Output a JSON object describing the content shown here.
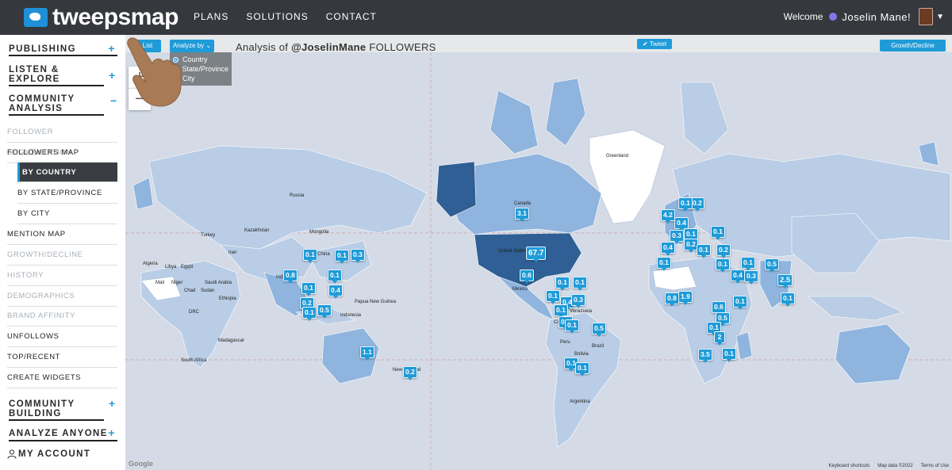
{
  "header": {
    "logo": "tweepsmap",
    "nav": [
      "PLANS",
      "SOLUTIONS",
      "CONTACT"
    ],
    "welcome": "Welcome",
    "user_name": "Joselin Mane!"
  },
  "sidebar": {
    "sections": [
      {
        "label": "PUBLISHING",
        "icon": "+"
      },
      {
        "label": "LISTEN & EXPLORE",
        "icon": "+"
      },
      {
        "label": "COMMUNITY ANALYSIS",
        "icon": "−"
      },
      {
        "label": "COMMUNITY BUILDING",
        "icon": "+"
      },
      {
        "label": "ANALYZE ANYONE",
        "icon": "+"
      },
      {
        "label": "MY ACCOUNT",
        "icon": "user-icon"
      }
    ],
    "items": [
      "FOLLOWER SEGMENTATION",
      "FOLLOWERS MAP",
      "BY COUNTRY",
      "BY STATE/PROVINCE",
      "BY CITY",
      "MENTION MAP",
      "GROWTH/DECLINE",
      "HISTORY",
      "DEMOGRAPHICS",
      "BRAND AFFINITY",
      "UNFOLLOWS",
      "TOP/RECENT",
      "CREATE WIDGETS"
    ]
  },
  "toolbar": {
    "list_label": "List",
    "analyze_label": "Analyze by",
    "tweet_label": "Tweet",
    "growth_label": "Growth/Decline",
    "title_prefix": "Analysis of",
    "title_handle": "@JoselinMane",
    "title_suffix": "FOLLOWERS"
  },
  "analyze_options": [
    "Country",
    "State/Province",
    "City"
  ],
  "analyze_selected": "Country",
  "zoom": {
    "in": "+",
    "out": "−"
  },
  "map_labels": [
    "Russia",
    "Greenland",
    "Kazakhstan",
    "Mongolia",
    "China",
    "India",
    "Iran",
    "Saudi Arabia",
    "Egypt",
    "Libya",
    "Algeria",
    "Mali",
    "Niger",
    "Chad",
    "Sudan",
    "Ethiopia",
    "DRC",
    "Madagascar",
    "South Africa",
    "Indonesia",
    "Papua New Guinea",
    "New Zealand",
    "Brazil",
    "Peru",
    "Bolivia",
    "Argentina",
    "Venezuela",
    "Colombia",
    "Mexico",
    "Canada",
    "United States",
    "Turkey"
  ],
  "markers": [
    "3.1",
    "67.7",
    "0.6",
    "0.1",
    "0.1",
    "0.1",
    "0.4",
    "0.3",
    "0.1",
    "0.1",
    "0.5",
    "0.1",
    "0.1",
    "0.1",
    "0.8",
    "0.1",
    "0.1",
    "0.4",
    "0.2",
    "0.1",
    "0.5",
    "0.3",
    "0.1",
    "0.1",
    "1.1",
    "0.2",
    "4.2",
    "0.2",
    "0.1",
    "0.4",
    "0.3",
    "0.1",
    "0.1",
    "0.4",
    "0.2",
    "0.1",
    "0.1",
    "0.2",
    "0.1",
    "0.1",
    "0.4",
    "0.3",
    "0.5",
    "2.5",
    "0.1",
    "0.8",
    "1.9",
    "0.6",
    "0.1",
    "0.5",
    "0.1",
    "2",
    "3.5",
    "0.1"
  ],
  "footer": {
    "google": "Google",
    "shortcuts": "Keyboard shortcuts",
    "mapdata": "Map data ©2022",
    "terms": "Terms of Use"
  },
  "colors": {
    "accent": "#1f9bd8",
    "topbar": "#35383d",
    "water": "#d4dbe6",
    "land_light": "#b9cde6",
    "land_mid": "#8fb4de",
    "land_dark": "#2f5f94"
  }
}
